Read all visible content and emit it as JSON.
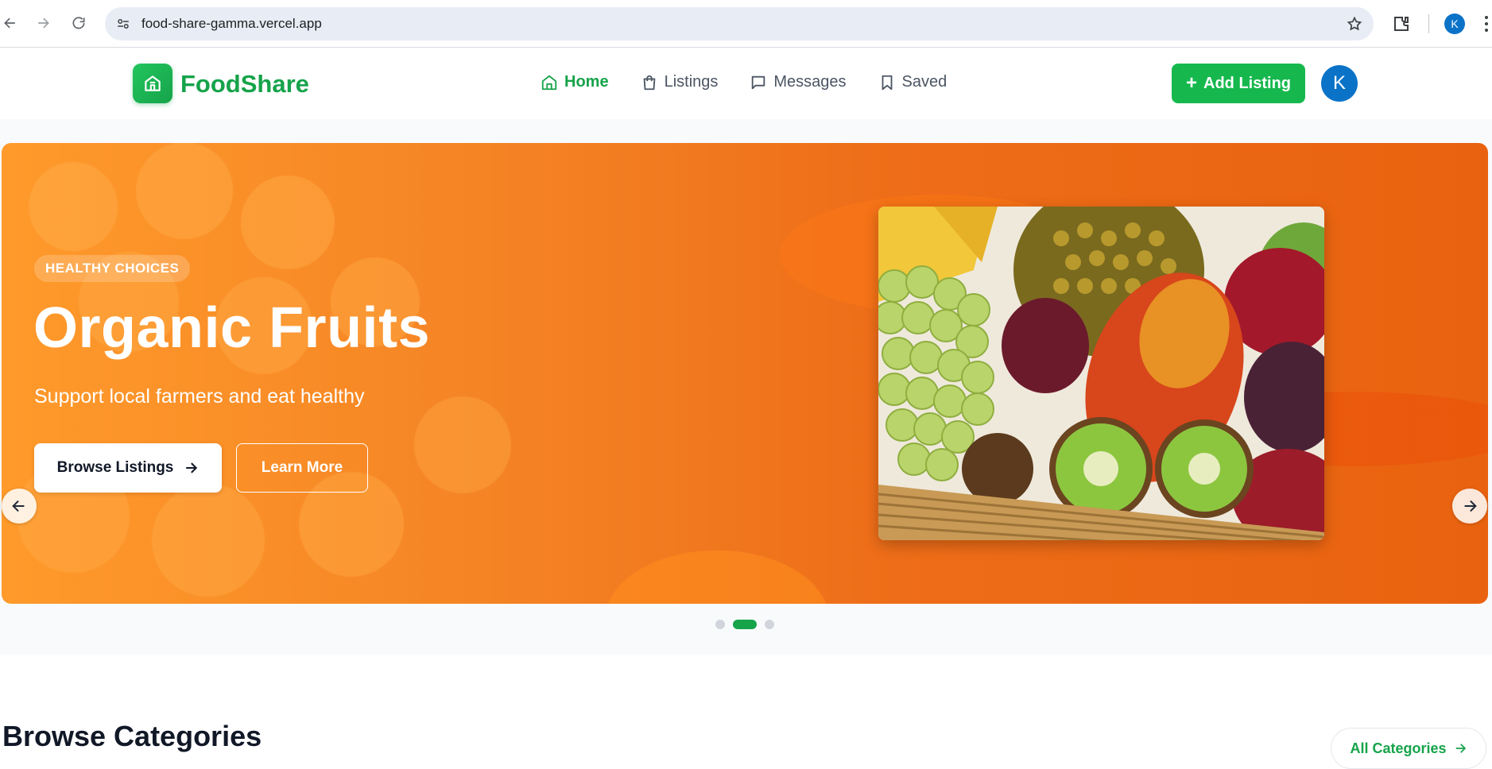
{
  "browser": {
    "url": "food-share-gamma.vercel.app",
    "profile_initial": "K"
  },
  "header": {
    "logo_text": "FoodShare",
    "nav": [
      {
        "label": "Home",
        "icon": "home-icon",
        "active": true
      },
      {
        "label": "Listings",
        "icon": "shopping-bag-icon",
        "active": false
      },
      {
        "label": "Messages",
        "icon": "message-icon",
        "active": false
      },
      {
        "label": "Saved",
        "icon": "bookmark-icon",
        "active": false
      }
    ],
    "add_listing_label": "Add Listing",
    "avatar_initial": "K"
  },
  "hero": {
    "badge": "HEALTHY CHOICES",
    "title": "Organic Fruits",
    "subtitle": "Support local farmers and eat healthy",
    "browse_label": "Browse Listings",
    "learn_label": "Learn More",
    "slide_count": 3,
    "active_slide": 2
  },
  "categories": {
    "title": "Browse Categories",
    "all_label": "All Categories"
  },
  "colors": {
    "brand_green": "#16a34a",
    "hero_orange": "#f07a1f",
    "avatar_blue": "#0b73c7"
  }
}
